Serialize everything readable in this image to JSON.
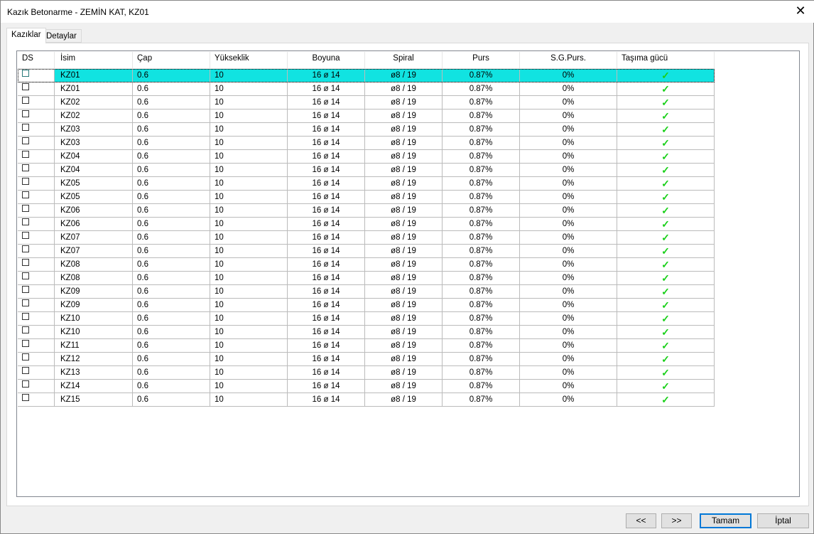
{
  "window": {
    "title": "Kazık Betonarme - ZEMİN KAT, KZ01",
    "close": "✕"
  },
  "tabs": [
    {
      "label": "Kazıklar",
      "active": true
    },
    {
      "label": "Detaylar",
      "active": false
    }
  ],
  "table": {
    "headers": [
      "DS",
      "İsim",
      "Çap",
      "Yükseklik",
      "Boyuna",
      "Spiral",
      "Purs",
      "S.G.Purs.",
      "Taşıma gücü"
    ],
    "rows": [
      [
        "KZ01",
        "0.6",
        "10",
        "16 ø 14",
        "ø8 / 19",
        "0.87%",
        "0%"
      ],
      [
        "KZ01",
        "0.6",
        "10",
        "16 ø 14",
        "ø8 / 19",
        "0.87%",
        "0%"
      ],
      [
        "KZ02",
        "0.6",
        "10",
        "16 ø 14",
        "ø8 / 19",
        "0.87%",
        "0%"
      ],
      [
        "KZ02",
        "0.6",
        "10",
        "16 ø 14",
        "ø8 / 19",
        "0.87%",
        "0%"
      ],
      [
        "KZ03",
        "0.6",
        "10",
        "16 ø 14",
        "ø8 / 19",
        "0.87%",
        "0%"
      ],
      [
        "KZ03",
        "0.6",
        "10",
        "16 ø 14",
        "ø8 / 19",
        "0.87%",
        "0%"
      ],
      [
        "KZ04",
        "0.6",
        "10",
        "16 ø 14",
        "ø8 / 19",
        "0.87%",
        "0%"
      ],
      [
        "KZ04",
        "0.6",
        "10",
        "16 ø 14",
        "ø8 / 19",
        "0.87%",
        "0%"
      ],
      [
        "KZ05",
        "0.6",
        "10",
        "16 ø 14",
        "ø8 / 19",
        "0.87%",
        "0%"
      ],
      [
        "KZ05",
        "0.6",
        "10",
        "16 ø 14",
        "ø8 / 19",
        "0.87%",
        "0%"
      ],
      [
        "KZ06",
        "0.6",
        "10",
        "16 ø 14",
        "ø8 / 19",
        "0.87%",
        "0%"
      ],
      [
        "KZ06",
        "0.6",
        "10",
        "16 ø 14",
        "ø8 / 19",
        "0.87%",
        "0%"
      ],
      [
        "KZ07",
        "0.6",
        "10",
        "16 ø 14",
        "ø8 / 19",
        "0.87%",
        "0%"
      ],
      [
        "KZ07",
        "0.6",
        "10",
        "16 ø 14",
        "ø8 / 19",
        "0.87%",
        "0%"
      ],
      [
        "KZ08",
        "0.6",
        "10",
        "16 ø 14",
        "ø8 / 19",
        "0.87%",
        "0%"
      ],
      [
        "KZ08",
        "0.6",
        "10",
        "16 ø 14",
        "ø8 / 19",
        "0.87%",
        "0%"
      ],
      [
        "KZ09",
        "0.6",
        "10",
        "16 ø 14",
        "ø8 / 19",
        "0.87%",
        "0%"
      ],
      [
        "KZ09",
        "0.6",
        "10",
        "16 ø 14",
        "ø8 / 19",
        "0.87%",
        "0%"
      ],
      [
        "KZ10",
        "0.6",
        "10",
        "16 ø 14",
        "ø8 / 19",
        "0.87%",
        "0%"
      ],
      [
        "KZ10",
        "0.6",
        "10",
        "16 ø 14",
        "ø8 / 19",
        "0.87%",
        "0%"
      ],
      [
        "KZ11",
        "0.6",
        "10",
        "16 ø 14",
        "ø8 / 19",
        "0.87%",
        "0%"
      ],
      [
        "KZ12",
        "0.6",
        "10",
        "16 ø 14",
        "ø8 / 19",
        "0.87%",
        "0%"
      ],
      [
        "KZ13",
        "0.6",
        "10",
        "16 ø 14",
        "ø8 / 19",
        "0.87%",
        "0%"
      ],
      [
        "KZ14",
        "0.6",
        "10",
        "16 ø 14",
        "ø8 / 19",
        "0.87%",
        "0%"
      ],
      [
        "KZ15",
        "0.6",
        "10",
        "16 ø 14",
        "ø8 / 19",
        "0.87%",
        "0%"
      ]
    ],
    "selected_row": 0,
    "check_glyph": "✓",
    "selection_color": "#11e3e1",
    "check_color": "#1ad01a"
  },
  "buttons": {
    "prev": "<<",
    "next": ">>",
    "ok": "Tamam",
    "cancel": "İptal"
  }
}
